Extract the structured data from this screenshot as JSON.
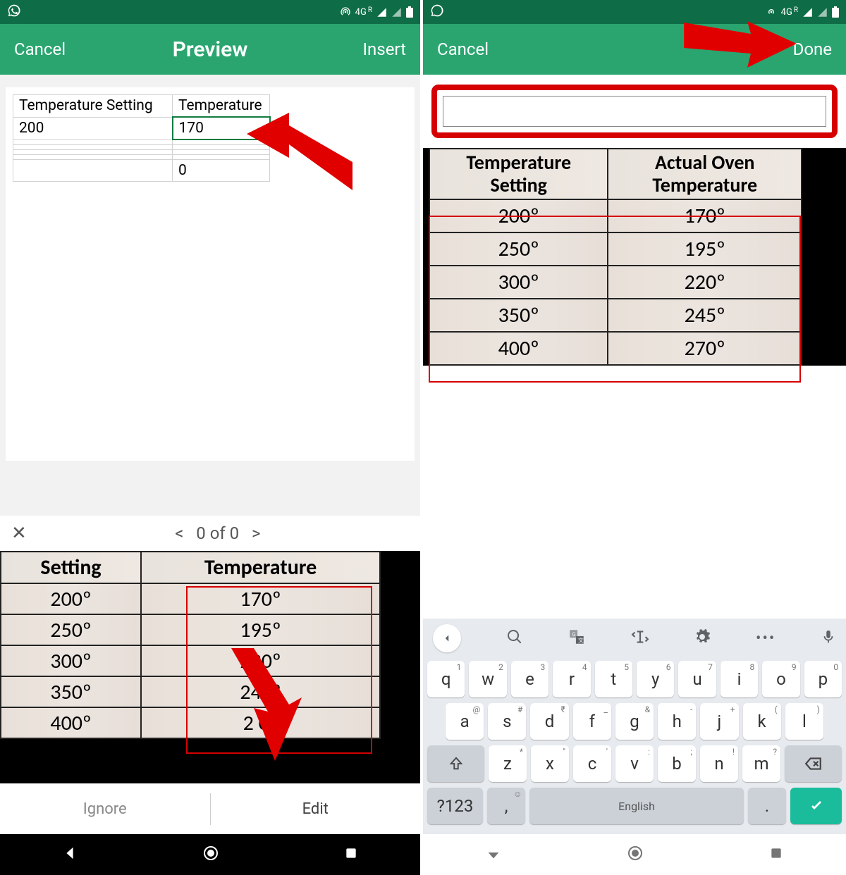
{
  "statusbar": {
    "signal": "4G",
    "roam": "R"
  },
  "left": {
    "cancel": "Cancel",
    "title": "Preview",
    "insert": "Insert",
    "table": {
      "headers": [
        "Temperature Setting",
        "Temperature"
      ],
      "row1": [
        "200",
        "170"
      ],
      "last": [
        "",
        "0"
      ]
    },
    "nav_count": "0 of 0",
    "photo": {
      "headers": [
        "Setting",
        "Temperature"
      ],
      "rows": [
        [
          "200º",
          "170º"
        ],
        [
          "250º",
          "195º"
        ],
        [
          "300º",
          "220º"
        ],
        [
          "350º",
          "245º"
        ],
        [
          "400º",
          "2   0º"
        ]
      ]
    },
    "ignore": "Ignore",
    "edit": "Edit"
  },
  "right": {
    "cancel": "Cancel",
    "done": "Done",
    "photo": {
      "headers": [
        "Temperature Setting",
        "Actual Oven Temperature"
      ],
      "rows": [
        [
          "200º",
          "170º"
        ],
        [
          "250º",
          "195º"
        ],
        [
          "300º",
          "220º"
        ],
        [
          "350º",
          "245º"
        ],
        [
          "400º",
          "270º"
        ]
      ]
    }
  },
  "keyboard": {
    "row1": [
      {
        "k": "q",
        "s": "1"
      },
      {
        "k": "w",
        "s": "2"
      },
      {
        "k": "e",
        "s": "3"
      },
      {
        "k": "r",
        "s": "4"
      },
      {
        "k": "t",
        "s": "5"
      },
      {
        "k": "y",
        "s": "6"
      },
      {
        "k": "u",
        "s": "7"
      },
      {
        "k": "i",
        "s": "8"
      },
      {
        "k": "o",
        "s": "9"
      },
      {
        "k": "p",
        "s": "0"
      }
    ],
    "row2": [
      {
        "k": "a",
        "s": "@"
      },
      {
        "k": "s",
        "s": "#"
      },
      {
        "k": "d",
        "s": "₹"
      },
      {
        "k": "f",
        "s": "_"
      },
      {
        "k": "g",
        "s": "&"
      },
      {
        "k": "h",
        "s": "-"
      },
      {
        "k": "j",
        "s": "+"
      },
      {
        "k": "k",
        "s": "("
      },
      {
        "k": "l",
        "s": ")"
      }
    ],
    "row3": [
      {
        "k": "z",
        "s": "*"
      },
      {
        "k": "x",
        "s": "\""
      },
      {
        "k": "c",
        "s": "'"
      },
      {
        "k": "v",
        "s": ":"
      },
      {
        "k": "b",
        "s": ";"
      },
      {
        "k": "n",
        "s": "!"
      },
      {
        "k": "m",
        "s": "?"
      }
    ],
    "switch": "?123",
    "space": "English",
    "period": "."
  }
}
